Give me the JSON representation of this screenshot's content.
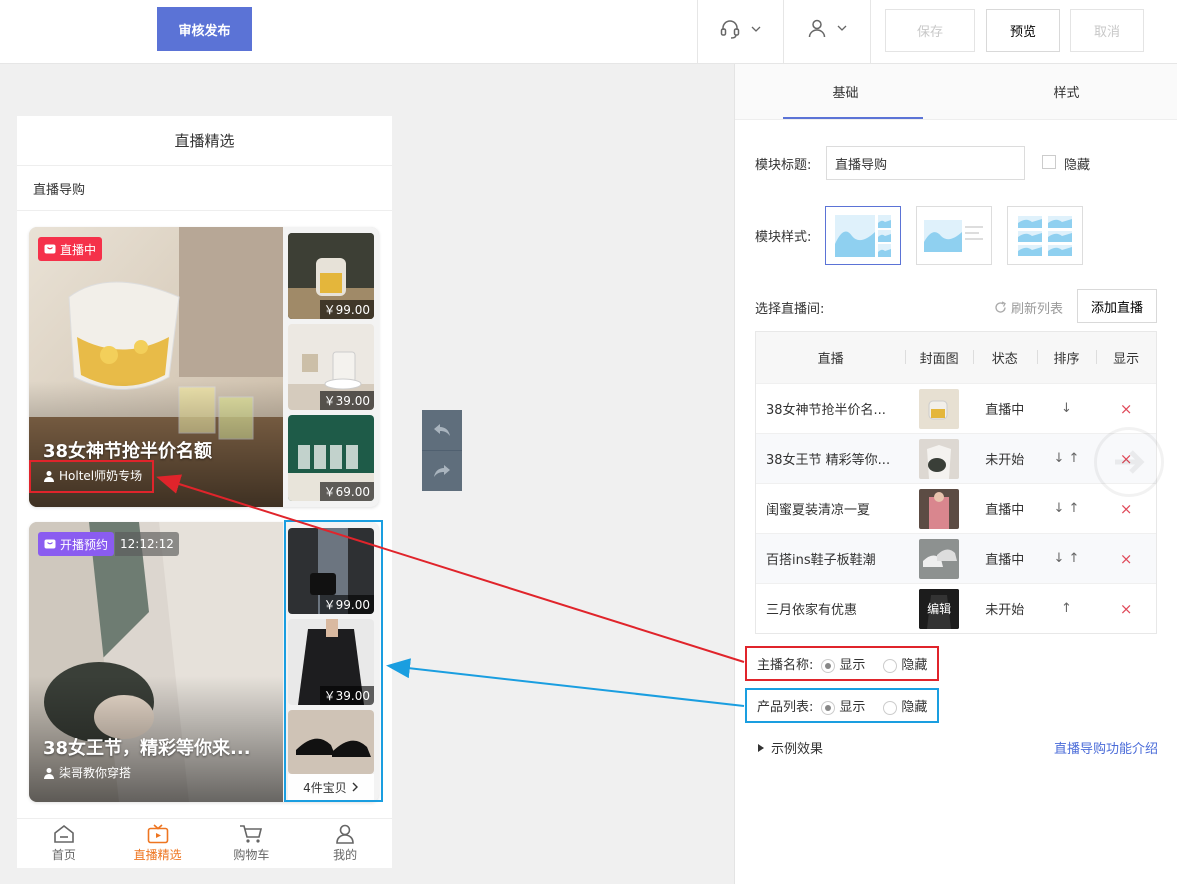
{
  "topbar": {
    "publish_label": "审核发布",
    "save_label": "保存",
    "preview_label": "预览",
    "cancel_label": "取消"
  },
  "phone": {
    "page_title": "直播精选",
    "section_title": "直播导购",
    "cards": [
      {
        "badge": "直播中",
        "headline": "38女神节抢半价名额",
        "host": "Holtel师奶专场",
        "thumbs": [
          {
            "price": "￥99.00"
          },
          {
            "price": "￥39.00"
          },
          {
            "price": "￥69.00"
          }
        ]
      },
      {
        "badge": "开播预约",
        "countdown": "12:12:12",
        "headline": "38女王节，精彩等你来...",
        "host": "柒哥教你穿搭",
        "thumbs": [
          {
            "price": "￥99.00"
          },
          {
            "price": "￥39.00"
          }
        ],
        "more_label": "4件宝贝"
      }
    ],
    "tabs": [
      {
        "label": "首页"
      },
      {
        "label": "直播精选"
      },
      {
        "label": "购物车"
      },
      {
        "label": "我的"
      }
    ]
  },
  "panel": {
    "tabs": [
      {
        "label": "基础"
      },
      {
        "label": "样式"
      }
    ],
    "title_label": "模块标题:",
    "title_value": "直播导购",
    "hide_label": "隐藏",
    "style_label": "模块样式:",
    "select_label": "选择直播间:",
    "refresh_label": "刷新列表",
    "add_label": "添加直播",
    "table": {
      "headers": [
        "直播",
        "封面图",
        "状态",
        "排序",
        "显示"
      ],
      "rows": [
        {
          "name": "38女神节抢半价名...",
          "status": "直播中",
          "sort": "↓",
          "cover_text": ""
        },
        {
          "name": "38女王节 精彩等你...",
          "status": "未开始",
          "sort": "↓ ↑",
          "cover_text": ""
        },
        {
          "name": "闺蜜夏装清凉一夏",
          "status": "直播中",
          "sort": "↓ ↑",
          "cover_text": ""
        },
        {
          "name": "百搭ins鞋子板鞋潮",
          "status": "直播中",
          "sort": "↓ ↑",
          "cover_text": ""
        },
        {
          "name": "三月依家有优惠",
          "status": "未开始",
          "sort": "↑",
          "cover_text": "编辑"
        }
      ],
      "remove_symbol": "×"
    },
    "host_name": {
      "label": "主播名称:",
      "show": "显示",
      "hide": "隐藏"
    },
    "product_list": {
      "label": "产品列表:",
      "show": "显示",
      "hide": "隐藏"
    },
    "example_label": "示例效果",
    "intro_link": "直播导购功能介绍"
  },
  "colors": {
    "accent": "#5b73d6",
    "live_badge": "#f5314a",
    "reserve_badge": "#8a5cf0",
    "tab_active": "#ee7520",
    "annot_red": "#e0242b",
    "annot_blue": "#1a9ee0"
  }
}
